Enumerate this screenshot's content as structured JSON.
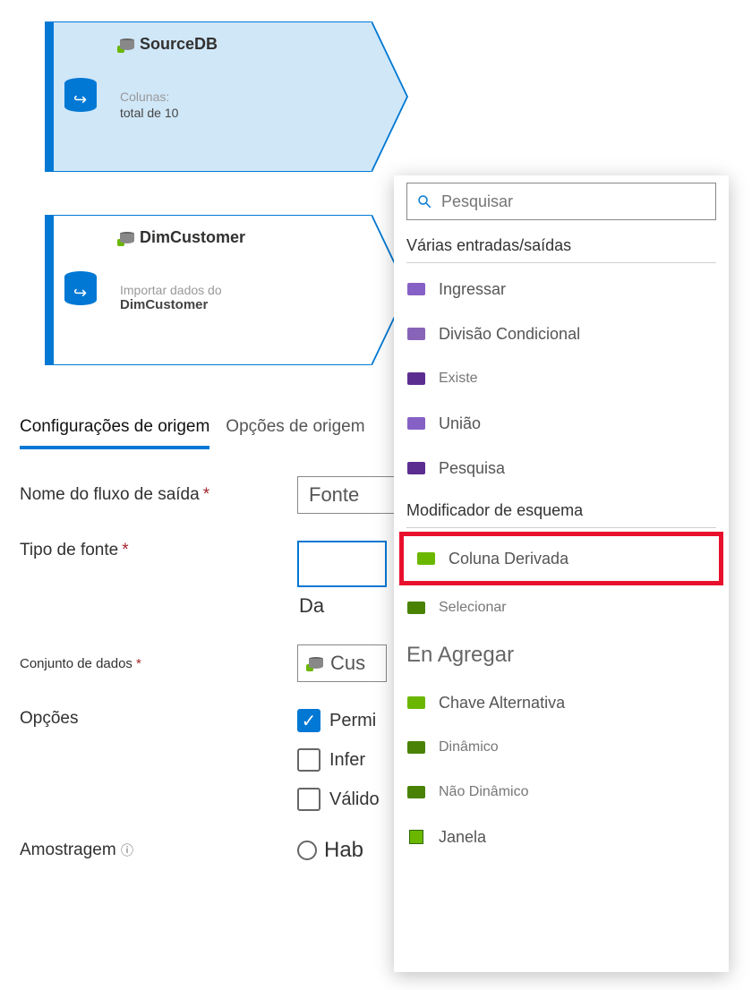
{
  "nodes": {
    "sourceDB": {
      "title": "SourceDB",
      "columns_label": "Colunas:",
      "columns_value": "total de 10"
    },
    "dimCustomer": {
      "title": "DimCustomer",
      "sub_label": "Importar dados do",
      "sub_value": "DimCustomer"
    }
  },
  "tabs": {
    "source_settings": "Configurações de origem",
    "source_options": "Opções de origem"
  },
  "form": {
    "output_name_label": "Nome do fluxo de saída",
    "output_name_value": "Fonte",
    "source_type_label": "Tipo de fonte",
    "source_type_sub": "Da",
    "dataset_label": "Conjunto de dados",
    "dataset_value": "Cus",
    "options_label": "Opções",
    "opt_allow": "Permi",
    "opt_infer": "Infer",
    "opt_valid": "Válido",
    "sampling_label": "Amostragem",
    "sampling_value": "Hab"
  },
  "popup": {
    "search_placeholder": "Pesquisar",
    "section_multi": "Várias entradas/saídas",
    "items_multi": {
      "join": "Ingressar",
      "conditional_split": "Divisão Condicional",
      "exists": "Existe",
      "union": "União",
      "lookup": "Pesquisa"
    },
    "section_schema": "Modificador de esquema",
    "items_schema": {
      "derived_column": "Coluna Derivada",
      "select": "Selecionar",
      "aggregate": "En Agregar",
      "surrogate_key": "Chave Alternativa",
      "pivot": "Dinâmico",
      "unpivot": "Não Dinâmico",
      "window": "Janela"
    }
  }
}
